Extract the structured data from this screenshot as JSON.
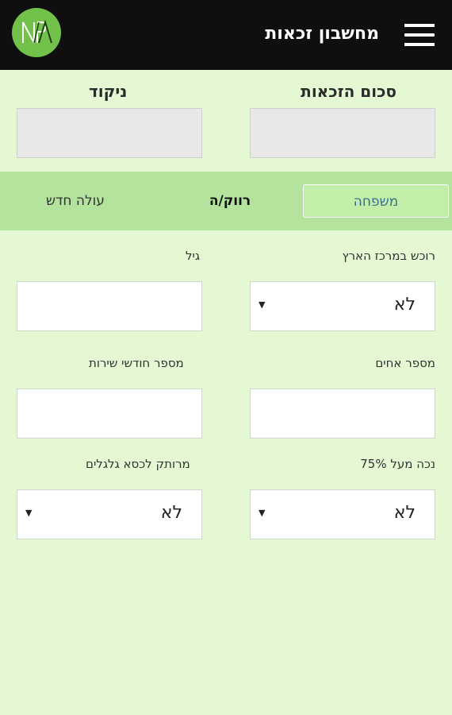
{
  "header": {
    "title": "מחשבון זכאות",
    "logo_text": "NPV"
  },
  "stats": {
    "total_label": "סכום הזכאות",
    "total_value": "",
    "score_label": "ניקוד",
    "score_value": ""
  },
  "tabs": [
    {
      "label": "משפחה"
    },
    {
      "label": "רווק/ה"
    },
    {
      "label": "עולה חדש"
    }
  ],
  "fields": {
    "center_owner": {
      "label": "רוכש במרכז הארץ",
      "value": "לא"
    },
    "age": {
      "label": "גיל",
      "value": ""
    },
    "siblings": {
      "label": "מספר אחים",
      "value": ""
    },
    "service_months": {
      "label": "מספר חודשי שירות",
      "value": ""
    },
    "disability": {
      "label": "נכה מעל 75%",
      "value": "לא"
    },
    "wheelchair": {
      "label": "מרותק לכסא גלגלים",
      "value": "לא"
    }
  }
}
